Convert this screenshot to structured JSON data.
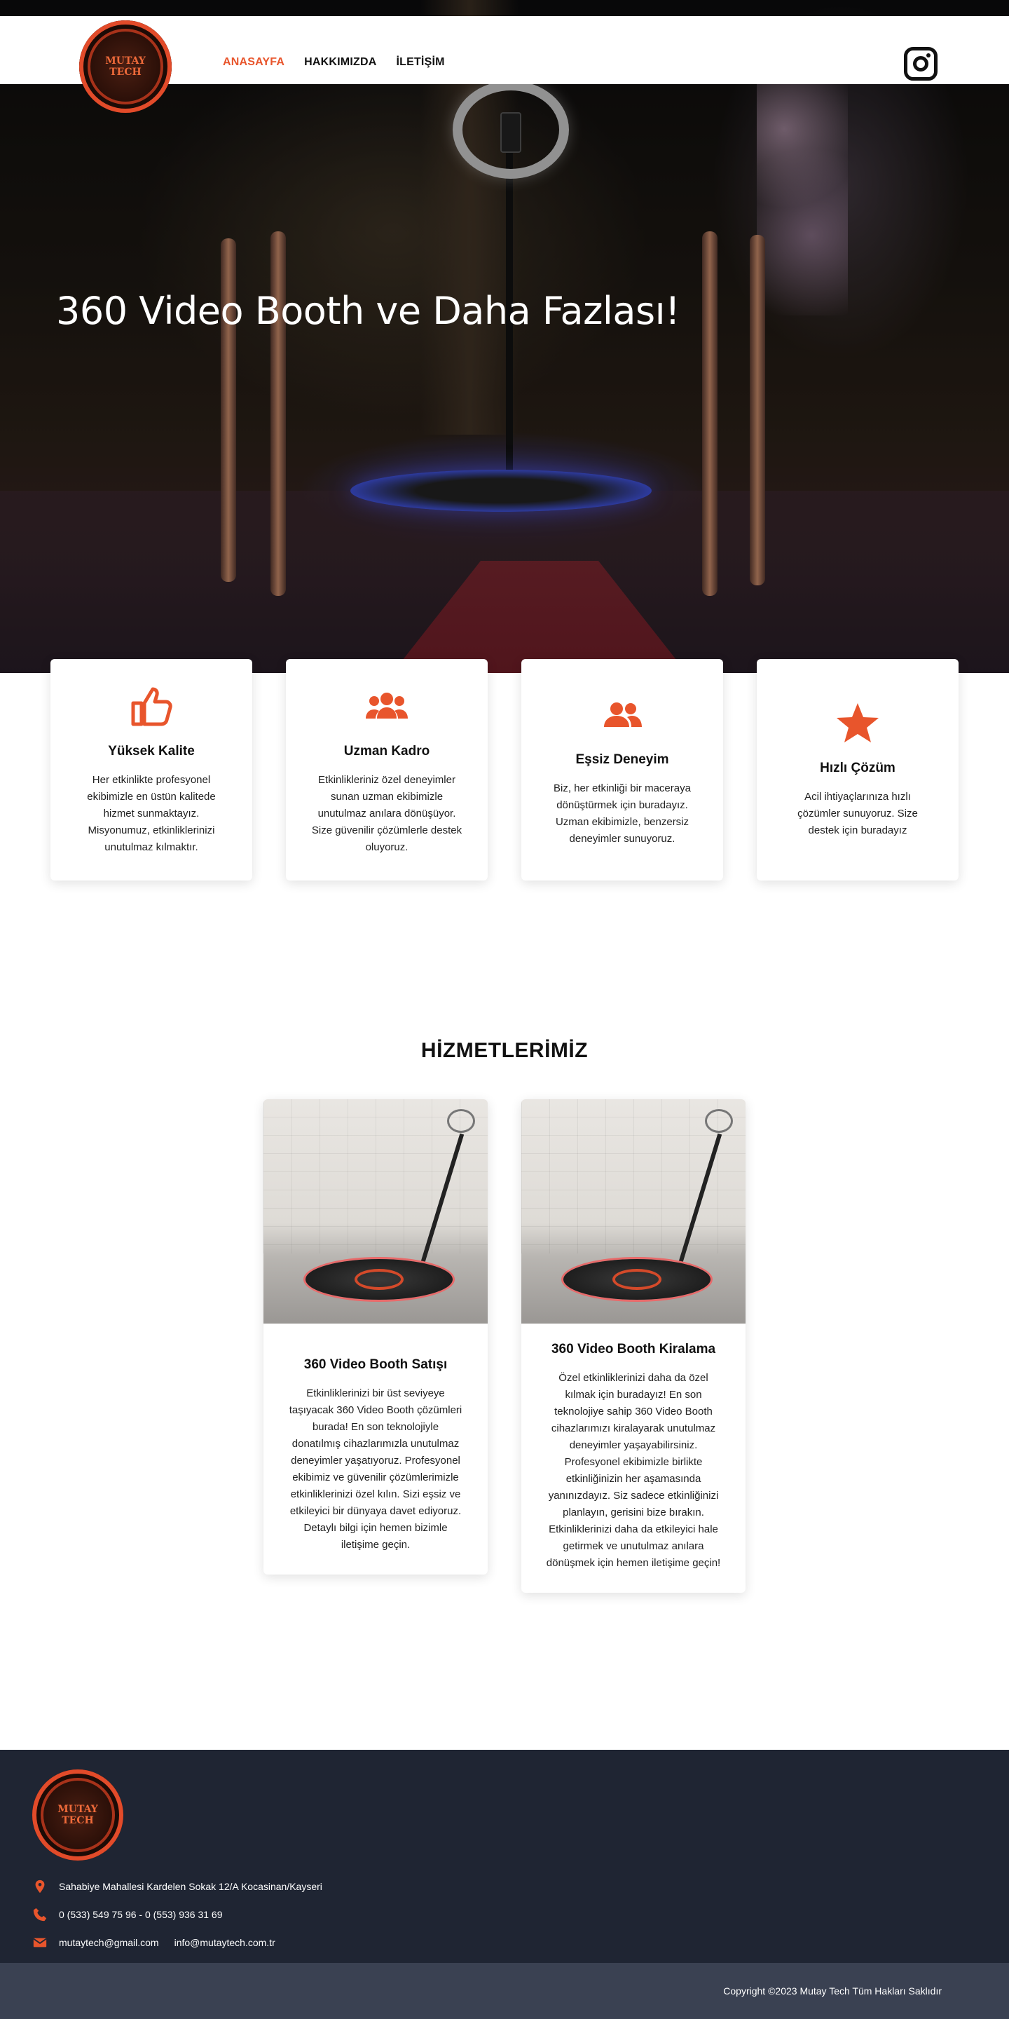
{
  "brand": {
    "logo_text": "MUTAY TECH",
    "accent_color": "#e8552c",
    "footer_bg": "#1f2533",
    "copyright_bg": "#3a4152"
  },
  "nav": {
    "items": [
      {
        "label": "ANASAYFA",
        "active": true
      },
      {
        "label": "HAKKIMIZDA",
        "active": false
      },
      {
        "label": "İLETİŞİM",
        "active": false
      }
    ],
    "social_icon": "instagram-icon"
  },
  "hero": {
    "title": "360 Video Booth ve Daha Fazlası!"
  },
  "features": [
    {
      "icon": "thumbs-up-icon",
      "title": "Yüksek Kalite",
      "text": "Her etkinlikte profesyonel ekibimizle en üstün kalitede hizmet sunmaktayız. Misyonumuz, etkinliklerinizi unutulmaz kılmaktır."
    },
    {
      "icon": "team-icon",
      "title": "Uzman Kadro",
      "text": "Etkinlikleriniz özel deneyimler sunan uzman ekibimizle unutulmaz anılara dönüşüyor. Size güvenilir çözümlerle destek oluyoruz."
    },
    {
      "icon": "users-icon",
      "title": "Eşsiz Deneyim",
      "text": "Biz, her etkinliği bir maceraya dönüştürmek için buradayız. Uzman ekibimizle, benzersiz deneyimler sunuyoruz."
    },
    {
      "icon": "star-icon",
      "title": "Hızlı Çözüm",
      "text": "Acil ihtiyaçlarınıza hızlı çözümler sunuyoruz. Size destek için buradayız"
    }
  ],
  "services": {
    "title": "HİZMETLERİMİZ",
    "items": [
      {
        "title": "360 Video Booth Satışı",
        "text": "Etkinliklerinizi bir üst seviyeye taşıyacak 360 Video Booth çözümleri burada! En son teknolojiyle donatılmış cihazlarımızla unutulmaz deneyimler yaşatıyoruz. Profesyonel ekibimiz ve güvenilir çözümlerimizle etkinliklerinizi özel kılın. Sizi eşsiz ve etkileyici bir dünyaya davet ediyoruz. Detaylı bilgi için hemen bizimle iletişime geçin."
      },
      {
        "title": "360 Video Booth Kiralama",
        "text": "Özel etkinliklerinizi daha da özel kılmak için buradayız! En son teknolojiye sahip 360 Video Booth cihazlarımızı kiralayarak unutulmaz deneyimler yaşayabilirsiniz. Profesyonel ekibimizle birlikte etkinliğinizin her aşamasında yanınızdayız. Siz sadece etkinliğinizi planlayın, gerisini bize bırakın. Etkinliklerinizi daha da etkileyici hale getirmek ve unutulmaz anılara dönüşmek için hemen iletişime geçin!"
      }
    ]
  },
  "footer": {
    "address": "Sahabiye Mahallesi Kardelen Sokak 12/A Kocasinan/Kayseri",
    "phone": "0 (533) 549 75 96 - 0 (553) 936 31 69",
    "email_1": "mutaytech@gmail.com",
    "email_2": "info@mutaytech.com.tr",
    "copyright": "Copyright ©2023 Mutay Tech Tüm Hakları Saklıdır"
  }
}
